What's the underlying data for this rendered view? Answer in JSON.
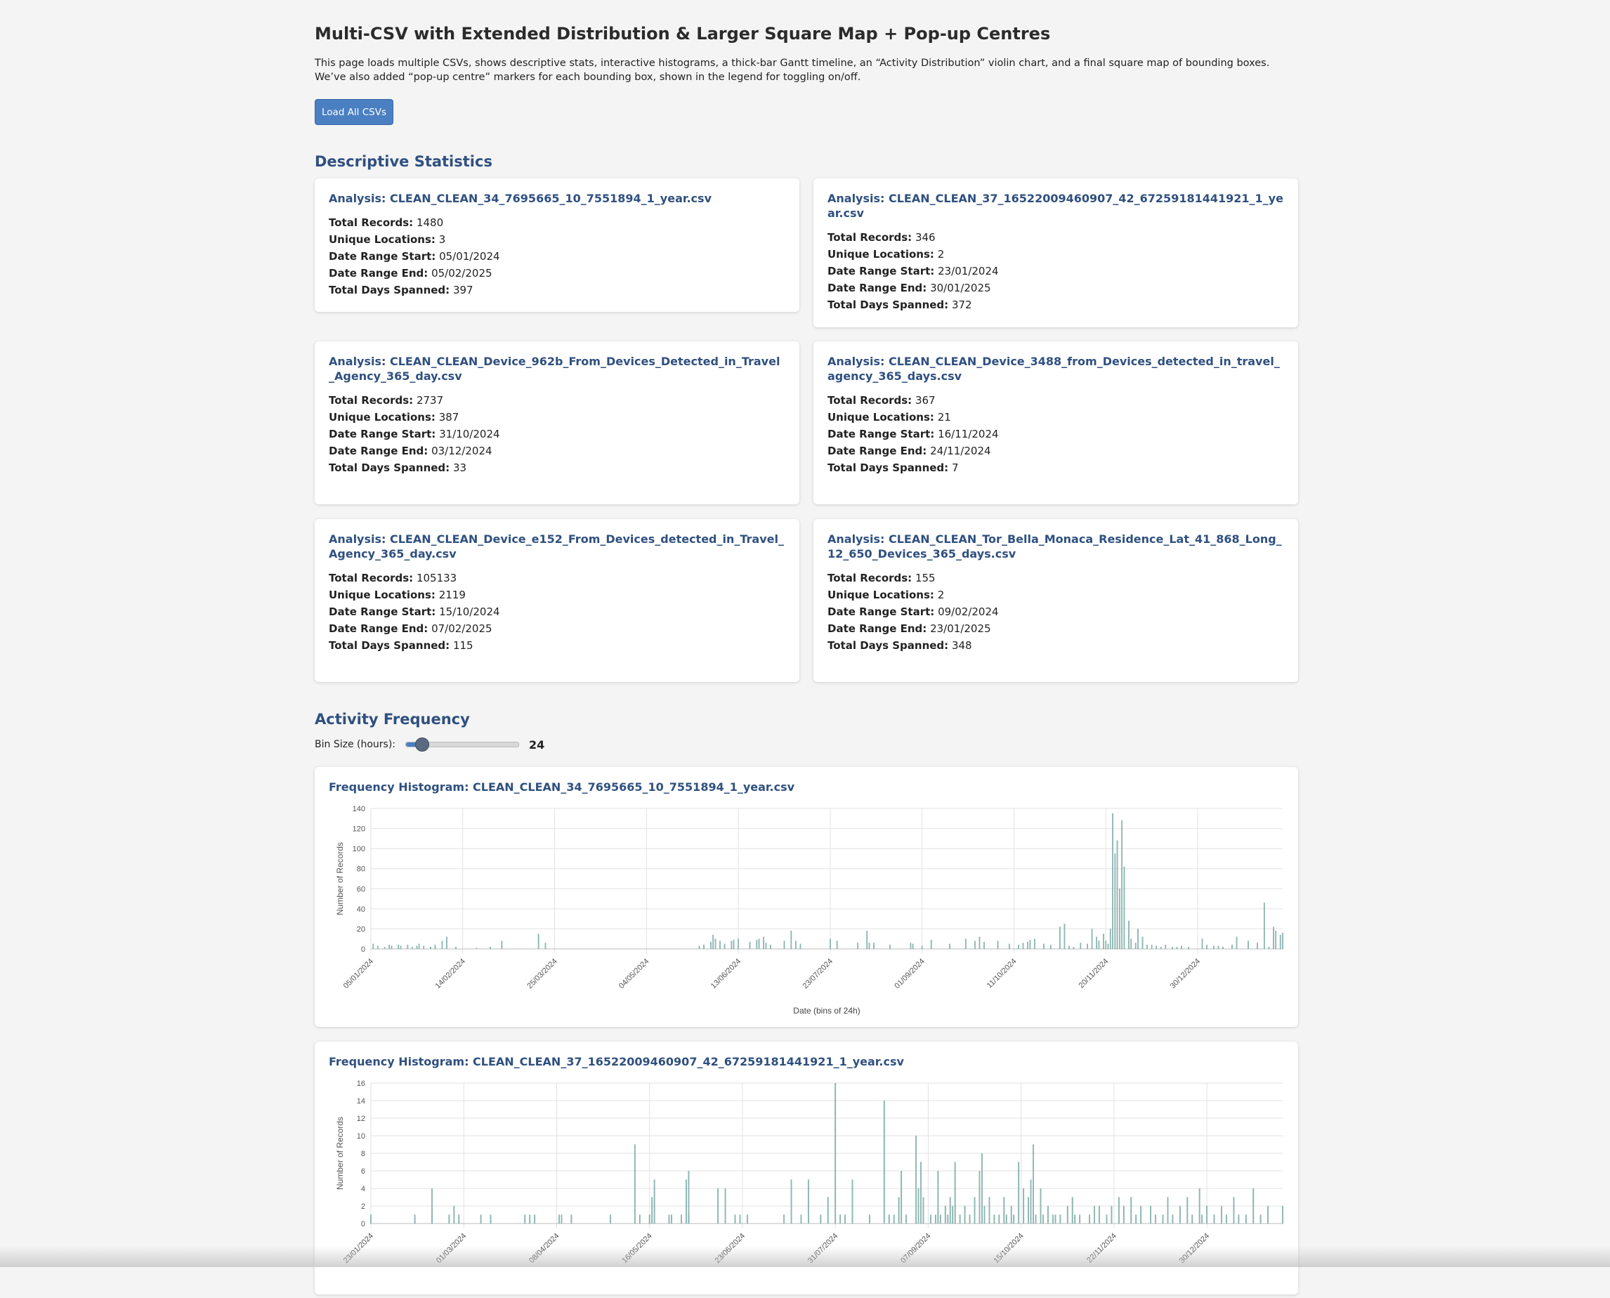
{
  "header": {
    "title": "Multi-CSV with Extended Distribution & Larger Square Map + Pop-up Centres",
    "intro": "This page loads multiple CSVs, shows descriptive stats, interactive histograms, a thick-bar Gantt timeline, an “Activity Distribution” violin chart, and a final square map of bounding boxes. We’ve also added “pop-up centre” markers for each bounding box, shown in the legend for toggling on/off.",
    "load_button": "Load All CSVs"
  },
  "stats_section": {
    "heading": "Descriptive Statistics",
    "labels": {
      "total_records": "Total Records:",
      "unique_locations": "Unique Locations:",
      "date_start": "Date Range Start:",
      "date_end": "Date Range End:",
      "days_spanned": "Total Days Spanned:"
    },
    "cards": [
      {
        "title": "Analysis: CLEAN_CLEAN_34_7695665_10_7551894_1_year.csv",
        "total_records": "1480",
        "unique_locations": "3",
        "date_start": "05/01/2024",
        "date_end": "05/02/2025",
        "days_spanned": "397"
      },
      {
        "title": "Analysis: CLEAN_CLEAN_37_16522009460907_42_67259181441921_1_year.csv",
        "total_records": "346",
        "unique_locations": "2",
        "date_start": "23/01/2024",
        "date_end": "30/01/2025",
        "days_spanned": "372"
      },
      {
        "title": "Analysis: CLEAN_CLEAN_Device_962b_From_Devices_Detected_in_Travel_Agency_365_day.csv",
        "total_records": "2737",
        "unique_locations": "387",
        "date_start": "31/10/2024",
        "date_end": "03/12/2024",
        "days_spanned": "33"
      },
      {
        "title": "Analysis: CLEAN_CLEAN_Device_3488_from_Devices_detected_in_travel_agency_365_days.csv",
        "total_records": "367",
        "unique_locations": "21",
        "date_start": "16/11/2024",
        "date_end": "24/11/2024",
        "days_spanned": "7"
      },
      {
        "title": "Analysis: CLEAN_CLEAN_Device_e152_From_Devices_detected_in_Travel_Agency_365_day.csv",
        "total_records": "105133",
        "unique_locations": "2119",
        "date_start": "15/10/2024",
        "date_end": "07/02/2025",
        "days_spanned": "115"
      },
      {
        "title": "Analysis: CLEAN_CLEAN_Tor_Bella_Monaca_Residence_Lat_41_868_Long_12_650_Devices_365_days.csv",
        "total_records": "155",
        "unique_locations": "2",
        "date_start": "09/02/2024",
        "date_end": "23/01/2025",
        "days_spanned": "348"
      }
    ]
  },
  "frequency_section": {
    "heading": "Activity Frequency",
    "slider_label": "Bin Size (hours):",
    "slider_value": "24",
    "slider_min": 1,
    "slider_max": 168
  },
  "colors": {
    "bar": "#8fb8b3",
    "grid": "#e2e2e2",
    "accent": "#4a7fc1",
    "heading": "#2f5080"
  },
  "chart_data": [
    {
      "type": "bar",
      "title": "Frequency Histogram: CLEAN_CLEAN_34_7695665_10_7551894_1_year.csv",
      "xlabel": "Date (bins of 24h)",
      "ylabel": "Number of Records",
      "ylim": [
        0,
        140
      ],
      "yticks": [
        0,
        20,
        40,
        60,
        80,
        100,
        120,
        140
      ],
      "xlim": [
        "2024-01-05",
        "2025-02-05"
      ],
      "xticks": [
        "2024-01-05",
        "2024-02-14",
        "2024-03-25",
        "2024-05-04",
        "2024-06-13",
        "2024-07-23",
        "2024-09-01",
        "2024-10-11",
        "2024-11-20",
        "2024-12-30"
      ],
      "xtick_labels": [
        "05/01/2024",
        "14/02/2024",
        "25/03/2024",
        "04/05/2024",
        "13/06/2024",
        "23/07/2024",
        "01/09/2024",
        "11/10/2024",
        "20/11/2024",
        "30/12/2024"
      ],
      "grid": true,
      "legend": "none",
      "points": [
        [
          "2024-01-06",
          5
        ],
        [
          "2024-01-08",
          3
        ],
        [
          "2024-01-11",
          2
        ],
        [
          "2024-01-13",
          4
        ],
        [
          "2024-01-14",
          3
        ],
        [
          "2024-01-17",
          4
        ],
        [
          "2024-01-18",
          3
        ],
        [
          "2024-01-21",
          4
        ],
        [
          "2024-01-23",
          2
        ],
        [
          "2024-01-25",
          3
        ],
        [
          "2024-01-26",
          5
        ],
        [
          "2024-01-28",
          3
        ],
        [
          "2024-01-31",
          2
        ],
        [
          "2024-02-02",
          4
        ],
        [
          "2024-02-05",
          8
        ],
        [
          "2024-02-07",
          12
        ],
        [
          "2024-02-11",
          2
        ],
        [
          "2024-02-20",
          1
        ],
        [
          "2024-02-26",
          2
        ],
        [
          "2024-03-02",
          8
        ],
        [
          "2024-03-18",
          15
        ],
        [
          "2024-03-21",
          6
        ],
        [
          "2024-05-27",
          3
        ],
        [
          "2024-05-29",
          4
        ],
        [
          "2024-06-01",
          7
        ],
        [
          "2024-06-02",
          14
        ],
        [
          "2024-06-03",
          10
        ],
        [
          "2024-06-05",
          8
        ],
        [
          "2024-06-07",
          5
        ],
        [
          "2024-06-10",
          8
        ],
        [
          "2024-06-11",
          9
        ],
        [
          "2024-06-13",
          10
        ],
        [
          "2024-06-18",
          7
        ],
        [
          "2024-06-21",
          9
        ],
        [
          "2024-06-22",
          10
        ],
        [
          "2024-06-24",
          12
        ],
        [
          "2024-06-25",
          6
        ],
        [
          "2024-06-27",
          4
        ],
        [
          "2024-07-03",
          8
        ],
        [
          "2024-07-06",
          18
        ],
        [
          "2024-07-08",
          8
        ],
        [
          "2024-07-10",
          5
        ],
        [
          "2024-07-23",
          10
        ],
        [
          "2024-07-26",
          8
        ],
        [
          "2024-08-04",
          6
        ],
        [
          "2024-08-08",
          18
        ],
        [
          "2024-08-09",
          6
        ],
        [
          "2024-08-11",
          6
        ],
        [
          "2024-08-18",
          4
        ],
        [
          "2024-08-27",
          6
        ],
        [
          "2024-08-28",
          5
        ],
        [
          "2024-09-01",
          3
        ],
        [
          "2024-09-05",
          9
        ],
        [
          "2024-09-13",
          5
        ],
        [
          "2024-09-20",
          10
        ],
        [
          "2024-09-24",
          8
        ],
        [
          "2024-09-26",
          12
        ],
        [
          "2024-09-28",
          7
        ],
        [
          "2024-10-04",
          8
        ],
        [
          "2024-10-09",
          5
        ],
        [
          "2024-10-13",
          4
        ],
        [
          "2024-10-15",
          6
        ],
        [
          "2024-10-17",
          7
        ],
        [
          "2024-10-18",
          9
        ],
        [
          "2024-10-20",
          10
        ],
        [
          "2024-10-24",
          5
        ],
        [
          "2024-10-27",
          4
        ],
        [
          "2024-10-31",
          22
        ],
        [
          "2024-11-02",
          25
        ],
        [
          "2024-11-04",
          3
        ],
        [
          "2024-11-06",
          2
        ],
        [
          "2024-11-09",
          6
        ],
        [
          "2024-11-12",
          5
        ],
        [
          "2024-11-14",
          20
        ],
        [
          "2024-11-16",
          12
        ],
        [
          "2024-11-17",
          8
        ],
        [
          "2024-11-19",
          15
        ],
        [
          "2024-11-20",
          8
        ],
        [
          "2024-11-21",
          5
        ],
        [
          "2024-11-22",
          20
        ],
        [
          "2024-11-23",
          135
        ],
        [
          "2024-11-24",
          95
        ],
        [
          "2024-11-25",
          108
        ],
        [
          "2024-11-26",
          60
        ],
        [
          "2024-11-27",
          128
        ],
        [
          "2024-11-28",
          82
        ],
        [
          "2024-11-30",
          28
        ],
        [
          "2024-12-01",
          10
        ],
        [
          "2024-12-03",
          6
        ],
        [
          "2024-12-04",
          20
        ],
        [
          "2024-12-06",
          12
        ],
        [
          "2024-12-08",
          4
        ],
        [
          "2024-12-10",
          4
        ],
        [
          "2024-12-12",
          3
        ],
        [
          "2024-12-14",
          2
        ],
        [
          "2024-12-16",
          4
        ],
        [
          "2024-12-19",
          2
        ],
        [
          "2024-12-21",
          2
        ],
        [
          "2024-12-23",
          3
        ],
        [
          "2024-12-26",
          2
        ],
        [
          "2025-01-01",
          10
        ],
        [
          "2025-01-03",
          4
        ],
        [
          "2025-01-06",
          3
        ],
        [
          "2025-01-08",
          3
        ],
        [
          "2025-01-10",
          2
        ],
        [
          "2025-01-14",
          4
        ],
        [
          "2025-01-16",
          12
        ],
        [
          "2025-01-21",
          8
        ],
        [
          "2025-01-25",
          6
        ],
        [
          "2025-01-28",
          46
        ],
        [
          "2025-01-30",
          2
        ],
        [
          "2025-02-01",
          22
        ],
        [
          "2025-02-02",
          18
        ],
        [
          "2025-02-04",
          14
        ],
        [
          "2025-02-05",
          16
        ]
      ]
    },
    {
      "type": "bar",
      "title": "Frequency Histogram: CLEAN_CLEAN_37_16522009460907_42_67259181441921_1_year.csv",
      "xlabel": "",
      "ylabel": "Number of Records",
      "ylim": [
        0,
        16
      ],
      "yticks": [
        0,
        2,
        4,
        6,
        8,
        10,
        12,
        14,
        16
      ],
      "xlim": [
        "2024-01-23",
        "2025-01-30"
      ],
      "xticks": [
        "2024-01-23",
        "2024-03-01",
        "2024-04-08",
        "2024-05-16",
        "2024-06-23",
        "2024-07-31",
        "2024-09-07",
        "2024-10-15",
        "2024-11-22",
        "2024-12-30"
      ],
      "xtick_labels": [
        "23/01/2024",
        "01/03/2024",
        "08/04/2024",
        "16/05/2024",
        "23/06/2024",
        "31/07/2024",
        "07/09/2024",
        "15/10/2024",
        "22/11/2024",
        "30/12/2024"
      ],
      "grid": true,
      "legend": "none",
      "points": [
        [
          "2024-01-23",
          1
        ],
        [
          "2024-02-10",
          1
        ],
        [
          "2024-02-17",
          4
        ],
        [
          "2024-02-17",
          1
        ],
        [
          "2024-02-24",
          1
        ],
        [
          "2024-02-26",
          2
        ],
        [
          "2024-02-28",
          1
        ],
        [
          "2024-03-08",
          1
        ],
        [
          "2024-03-12",
          1
        ],
        [
          "2024-03-26",
          1
        ],
        [
          "2024-03-28",
          1
        ],
        [
          "2024-03-30",
          1
        ],
        [
          "2024-04-09",
          1
        ],
        [
          "2024-04-10",
          1
        ],
        [
          "2024-04-14",
          1
        ],
        [
          "2024-04-30",
          1
        ],
        [
          "2024-05-10",
          9
        ],
        [
          "2024-05-12",
          1
        ],
        [
          "2024-05-16",
          1
        ],
        [
          "2024-05-17",
          3
        ],
        [
          "2024-05-18",
          5
        ],
        [
          "2024-05-24",
          1
        ],
        [
          "2024-05-25",
          1
        ],
        [
          "2024-05-29",
          1
        ],
        [
          "2024-05-31",
          5
        ],
        [
          "2024-06-01",
          6
        ],
        [
          "2024-06-01",
          1
        ],
        [
          "2024-06-13",
          4
        ],
        [
          "2024-06-16",
          4
        ],
        [
          "2024-06-20",
          1
        ],
        [
          "2024-06-22",
          1
        ],
        [
          "2024-06-25",
          1
        ],
        [
          "2024-07-10",
          1
        ],
        [
          "2024-07-13",
          5
        ],
        [
          "2024-07-17",
          1
        ],
        [
          "2024-07-20",
          5
        ],
        [
          "2024-07-25",
          1
        ],
        [
          "2024-07-28",
          3
        ],
        [
          "2024-07-31",
          16
        ],
        [
          "2024-08-02",
          1
        ],
        [
          "2024-08-04",
          1
        ],
        [
          "2024-08-07",
          5
        ],
        [
          "2024-08-14",
          1
        ],
        [
          "2024-08-20",
          14
        ],
        [
          "2024-08-22",
          1
        ],
        [
          "2024-08-24",
          1
        ],
        [
          "2024-08-26",
          3
        ],
        [
          "2024-08-27",
          6
        ],
        [
          "2024-08-29",
          1
        ],
        [
          "2024-09-02",
          10
        ],
        [
          "2024-09-03",
          4
        ],
        [
          "2024-09-04",
          7
        ],
        [
          "2024-09-05",
          3
        ],
        [
          "2024-09-08",
          1
        ],
        [
          "2024-09-10",
          1
        ],
        [
          "2024-09-11",
          6
        ],
        [
          "2024-09-12",
          1
        ],
        [
          "2024-09-14",
          2
        ],
        [
          "2024-09-15",
          1
        ],
        [
          "2024-09-16",
          3
        ],
        [
          "2024-09-17",
          2
        ],
        [
          "2024-09-18",
          7
        ],
        [
          "2024-09-20",
          1
        ],
        [
          "2024-09-22",
          2
        ],
        [
          "2024-09-24",
          1
        ],
        [
          "2024-09-26",
          3
        ],
        [
          "2024-09-28",
          6
        ],
        [
          "2024-09-29",
          8
        ],
        [
          "2024-09-30",
          2
        ],
        [
          "2024-10-02",
          3
        ],
        [
          "2024-10-04",
          1
        ],
        [
          "2024-10-06",
          1
        ],
        [
          "2024-10-08",
          3
        ],
        [
          "2024-10-09",
          1
        ],
        [
          "2024-10-11",
          2
        ],
        [
          "2024-10-12",
          1
        ],
        [
          "2024-10-14",
          7
        ],
        [
          "2024-10-16",
          4
        ],
        [
          "2024-10-18",
          3
        ],
        [
          "2024-10-19",
          5
        ],
        [
          "2024-10-20",
          9
        ],
        [
          "2024-10-21",
          1
        ],
        [
          "2024-10-23",
          4
        ],
        [
          "2024-10-24",
          1
        ],
        [
          "2024-10-26",
          2
        ],
        [
          "2024-10-28",
          1
        ],
        [
          "2024-10-29",
          1
        ],
        [
          "2024-10-31",
          1
        ],
        [
          "2024-11-03",
          2
        ],
        [
          "2024-11-05",
          3
        ],
        [
          "2024-11-06",
          1
        ],
        [
          "2024-11-08",
          1
        ],
        [
          "2024-11-12",
          1
        ],
        [
          "2024-11-14",
          2
        ],
        [
          "2024-11-16",
          2
        ],
        [
          "2024-11-19",
          1
        ],
        [
          "2024-11-21",
          2
        ],
        [
          "2024-11-24",
          3
        ],
        [
          "2024-11-26",
          2
        ],
        [
          "2024-11-29",
          3
        ],
        [
          "2024-12-01",
          1
        ],
        [
          "2024-12-03",
          2
        ],
        [
          "2024-12-07",
          2
        ],
        [
          "2024-12-09",
          1
        ],
        [
          "2024-12-12",
          1
        ],
        [
          "2024-12-14",
          3
        ],
        [
          "2024-12-16",
          1
        ],
        [
          "2024-12-19",
          2
        ],
        [
          "2024-12-22",
          3
        ],
        [
          "2024-12-24",
          1
        ],
        [
          "2024-12-27",
          4
        ],
        [
          "2024-12-28",
          1
        ],
        [
          "2024-12-30",
          2
        ],
        [
          "2025-01-02",
          1
        ],
        [
          "2025-01-05",
          2
        ],
        [
          "2025-01-07",
          1
        ],
        [
          "2025-01-10",
          3
        ],
        [
          "2025-01-12",
          1
        ],
        [
          "2025-01-15",
          1
        ],
        [
          "2025-01-18",
          4
        ],
        [
          "2025-01-21",
          1
        ],
        [
          "2025-01-24",
          2
        ],
        [
          "2025-01-30",
          2
        ]
      ]
    }
  ]
}
